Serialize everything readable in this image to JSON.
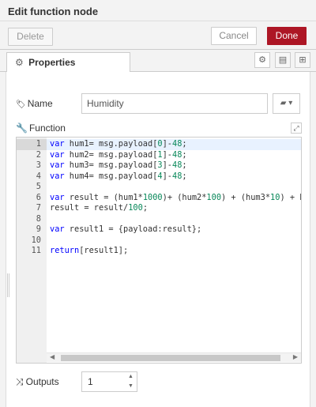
{
  "header": {
    "title": "Edit function node"
  },
  "toolbar": {
    "delete_label": "Delete",
    "cancel_label": "Cancel",
    "done_label": "Done"
  },
  "tabs": {
    "properties_label": "Properties"
  },
  "form": {
    "name_label": "Name",
    "name_value": "Humidity",
    "function_label": "Function",
    "outputs_label": "Outputs",
    "outputs_value": "1"
  },
  "code_lines": [
    [
      [
        "var",
        "kw"
      ],
      [
        " hum1= msg.payload[",
        ""
      ],
      [
        "0",
        "nm"
      ],
      [
        "]-",
        ""
      ],
      [
        "48",
        "nm"
      ],
      [
        ";",
        ""
      ]
    ],
    [
      [
        "var",
        "kw"
      ],
      [
        " hum2= msg.payload[",
        ""
      ],
      [
        "1",
        "nm"
      ],
      [
        "]-",
        ""
      ],
      [
        "48",
        "nm"
      ],
      [
        ";",
        ""
      ]
    ],
    [
      [
        "var",
        "kw"
      ],
      [
        " hum3= msg.payload[",
        ""
      ],
      [
        "3",
        "nm"
      ],
      [
        "]-",
        ""
      ],
      [
        "48",
        "nm"
      ],
      [
        ";",
        ""
      ]
    ],
    [
      [
        "var",
        "kw"
      ],
      [
        " hum4= msg.payload[",
        ""
      ],
      [
        "4",
        "nm"
      ],
      [
        "]-",
        ""
      ],
      [
        "48",
        "nm"
      ],
      [
        ";",
        ""
      ]
    ],
    [],
    [
      [
        "var",
        "kw"
      ],
      [
        " result = (hum1*",
        ""
      ],
      [
        "1000",
        "nm"
      ],
      [
        ")+ (hum2*",
        ""
      ],
      [
        "100",
        "nm"
      ],
      [
        ") + (hum3*",
        ""
      ],
      [
        "10",
        "nm"
      ],
      [
        ") + hu",
        ""
      ]
    ],
    [
      [
        "result = result/",
        ""
      ],
      [
        "100",
        "nm"
      ],
      [
        ";",
        ""
      ]
    ],
    [],
    [
      [
        "var",
        "kw"
      ],
      [
        " result1 = {payload:result};",
        ""
      ]
    ],
    [],
    [
      [
        "return",
        "kw"
      ],
      [
        "[result1];",
        ""
      ]
    ]
  ],
  "colors": {
    "done_button": "#ad1625",
    "keyword": "#0000ff",
    "number": "#09885a"
  },
  "icons": [
    "gear-icon",
    "tag-icon",
    "wrench-icon",
    "shuffle-icon",
    "book-icon",
    "expand-icon",
    "description-icon",
    "appearance-icon"
  ]
}
